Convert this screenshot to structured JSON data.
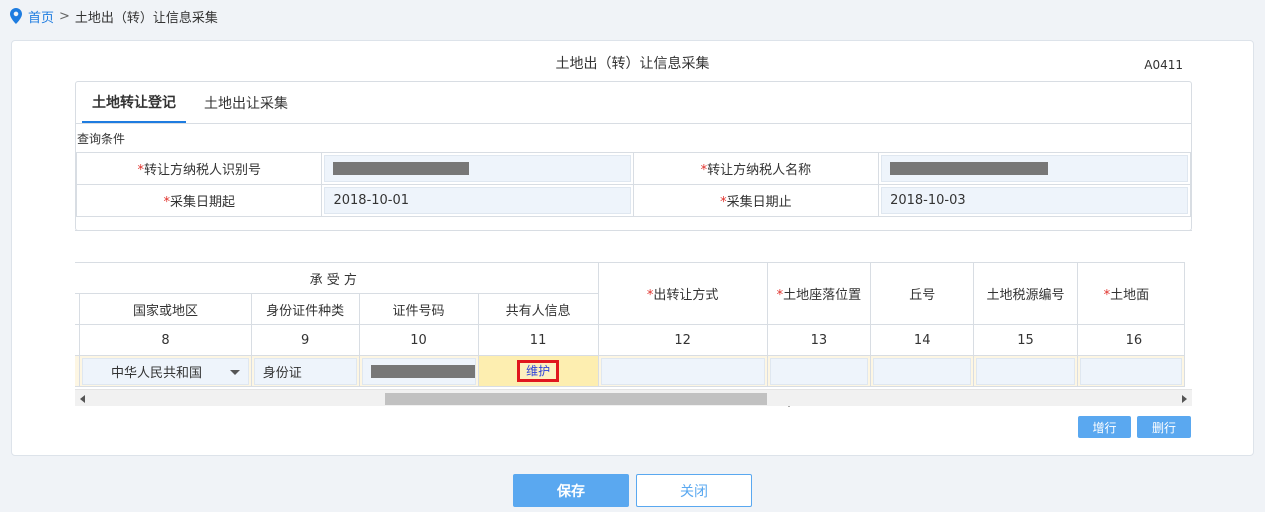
{
  "breadcrumb": {
    "home": "首页",
    "separator": ">",
    "current": "土地出（转）让信息采集"
  },
  "page": {
    "title": "土地出（转）让信息采集",
    "code": "A0411"
  },
  "tabs": [
    {
      "label": "土地转让登记",
      "active": true
    },
    {
      "label": "土地出让采集",
      "active": false
    }
  ],
  "query": {
    "section_label": "查询条件",
    "required_mark": "*",
    "fields": {
      "seller_tax_id": {
        "label": "转让方纳税人识别号",
        "value": ""
      },
      "seller_name": {
        "label": "转让方纳税人名称",
        "value": ""
      },
      "date_from": {
        "label": "采集日期起",
        "value": "2018-10-01"
      },
      "date_to": {
        "label": "采集日期止",
        "value": "2018-10-03"
      }
    }
  },
  "grid": {
    "group_header": "承 受 方",
    "columns": [
      {
        "label": "国家或地区",
        "num": "8",
        "required": false
      },
      {
        "label": "身份证件种类",
        "num": "9",
        "required": false
      },
      {
        "label": "证件号码",
        "num": "10",
        "required": false
      },
      {
        "label": "共有人信息",
        "num": "11",
        "required": false
      },
      {
        "label": "出转让方式",
        "num": "12",
        "required": true
      },
      {
        "label": "土地座落位置",
        "num": "13",
        "required": true
      },
      {
        "label": "丘号",
        "num": "14",
        "required": false
      },
      {
        "label": "土地税源编号",
        "num": "15",
        "required": false
      },
      {
        "label": "土地面",
        "num": "16",
        "required": true
      }
    ],
    "row": {
      "country": "中华人民共和国",
      "id_type": "身份证",
      "id_number": "",
      "coowner_action": "维护",
      "transfer_method": "",
      "location": "",
      "parcel_no": "",
      "tax_source_no": "",
      "area": ""
    }
  },
  "actions": {
    "add_row": "增行",
    "delete_row": "删行",
    "save": "保存",
    "close": "关闭"
  },
  "colors": {
    "accent": "#1e7ce0",
    "button": "#5aa8f0",
    "highlight_border": "#e0161e"
  }
}
